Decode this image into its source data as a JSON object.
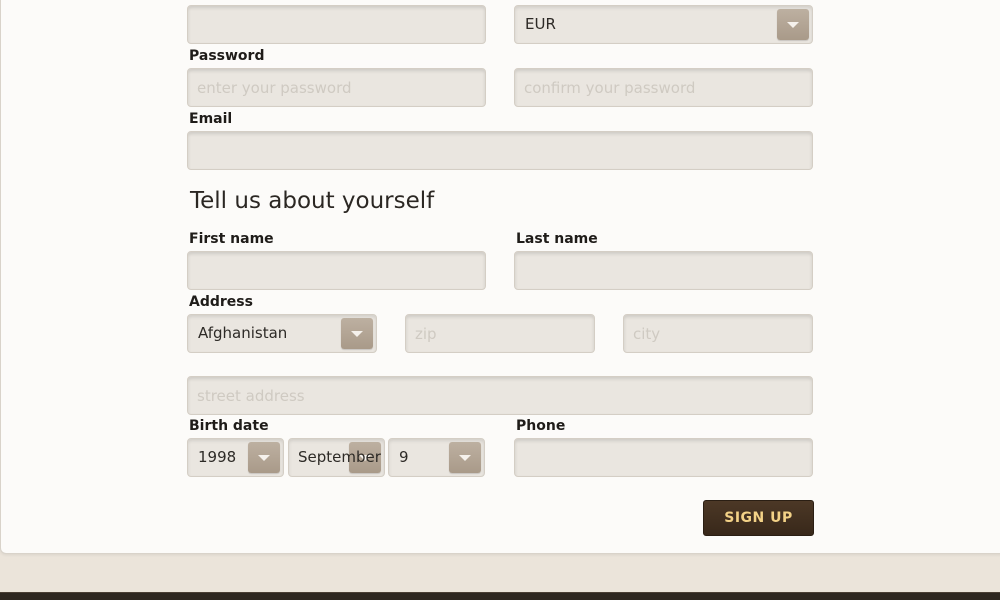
{
  "account": {
    "username_value": "",
    "currency": "EUR",
    "password_label": "Password",
    "password_placeholder": "enter your password",
    "confirm_password_placeholder": "confirm your password",
    "email_label": "Email",
    "email_value": ""
  },
  "about": {
    "heading": "Tell us about yourself",
    "first_name_label": "First name",
    "first_name_value": "",
    "last_name_label": "Last name",
    "last_name_value": "",
    "address_label": "Address",
    "country": "Afghanistan",
    "zip_placeholder": "zip",
    "city_placeholder": "city",
    "street_placeholder": "street address",
    "birth_date_label": "Birth date",
    "birth_year": "1998",
    "birth_month": "September",
    "birth_day": "9",
    "phone_label": "Phone",
    "phone_value": ""
  },
  "actions": {
    "signup_label": "SIGN UP"
  },
  "icons": {
    "dropdown": "chevron-down-icon"
  },
  "colors": {
    "signup_background": "#3f2e1f",
    "signup_text": "#f3d287",
    "dropdown_button": "#b3a594"
  }
}
